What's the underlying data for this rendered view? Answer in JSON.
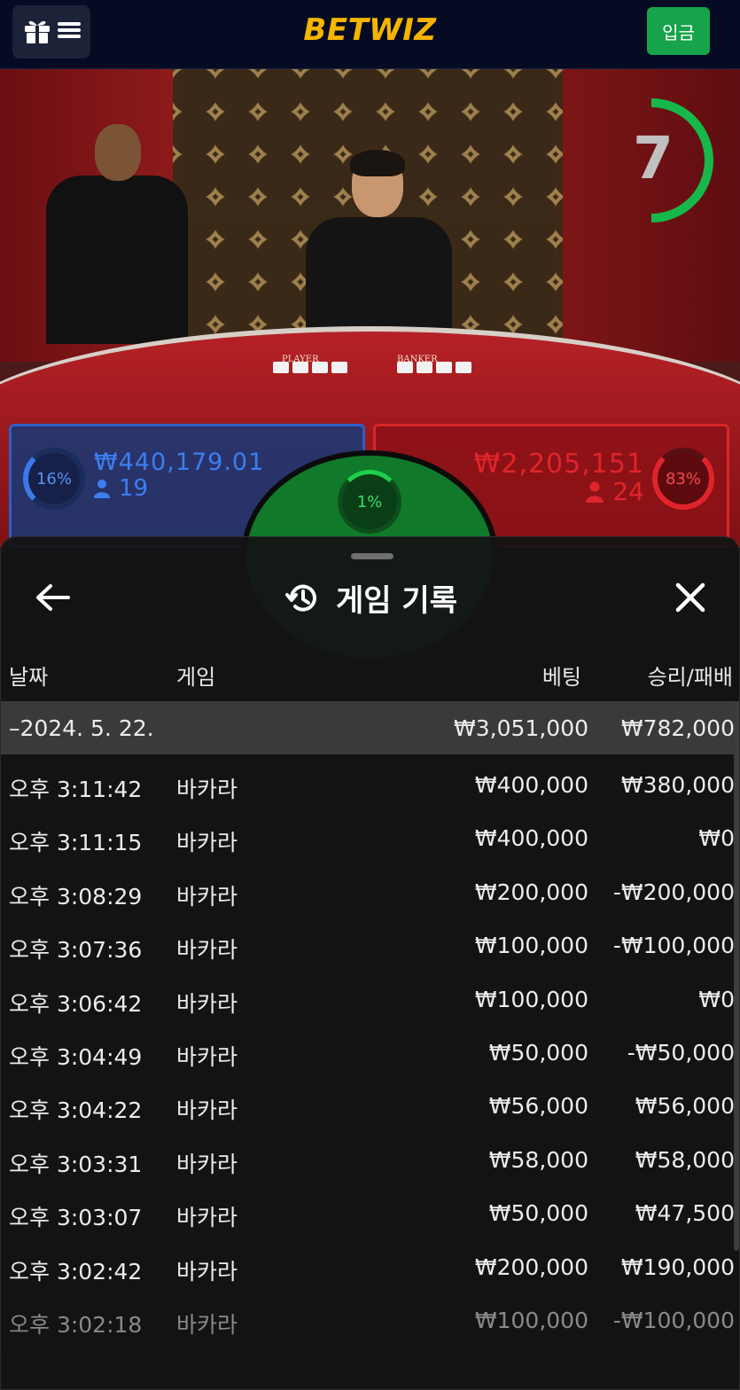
{
  "topbar": {
    "logo": "BETWIZ",
    "deposit_label": "입금",
    "menu_icons": [
      "gift-icon",
      "hamburger-icon"
    ]
  },
  "game": {
    "timer": "7",
    "player_label": "PLAYER",
    "banker_label": "BANKER",
    "player": {
      "percent": "16%",
      "amount": "₩440,179.01",
      "users": "19"
    },
    "banker": {
      "percent": "83%",
      "amount": "₩2,205,151",
      "users": "24"
    },
    "tie": {
      "percent": "1%"
    },
    "colors": {
      "player": "#2f5fc4",
      "banker": "#d9262c",
      "tie": "#107a2a",
      "deposit": "#17a34a",
      "logo": "#f4b400"
    }
  },
  "history": {
    "title": "게임 기록",
    "columns": {
      "date": "날짜",
      "game": "게임",
      "bet": "베팅",
      "result": "승리/패배"
    },
    "summary": {
      "date": "–2024. 5. 22.",
      "bet": "₩3,051,000",
      "result": "₩782,000"
    },
    "rows": [
      {
        "time": "오후 3:11:42",
        "game": "바카라",
        "bet": "₩400,000",
        "result": "₩380,000"
      },
      {
        "time": "오후 3:11:15",
        "game": "바카라",
        "bet": "₩400,000",
        "result": "₩0"
      },
      {
        "time": "오후 3:08:29",
        "game": "바카라",
        "bet": "₩200,000",
        "result": "-₩200,000"
      },
      {
        "time": "오후 3:07:36",
        "game": "바카라",
        "bet": "₩100,000",
        "result": "-₩100,000"
      },
      {
        "time": "오후 3:06:42",
        "game": "바카라",
        "bet": "₩100,000",
        "result": "₩0"
      },
      {
        "time": "오후 3:04:49",
        "game": "바카라",
        "bet": "₩50,000",
        "result": "-₩50,000"
      },
      {
        "time": "오후 3:04:22",
        "game": "바카라",
        "bet": "₩56,000",
        "result": "₩56,000"
      },
      {
        "time": "오후 3:03:31",
        "game": "바카라",
        "bet": "₩58,000",
        "result": "₩58,000"
      },
      {
        "time": "오후 3:03:07",
        "game": "바카라",
        "bet": "₩50,000",
        "result": "₩47,500"
      },
      {
        "time": "오후 3:02:42",
        "game": "바카라",
        "bet": "₩200,000",
        "result": "₩190,000"
      },
      {
        "time": "오후 3:02:18",
        "game": "바카라",
        "bet": "₩100,000",
        "result": "-₩100,000"
      }
    ]
  }
}
